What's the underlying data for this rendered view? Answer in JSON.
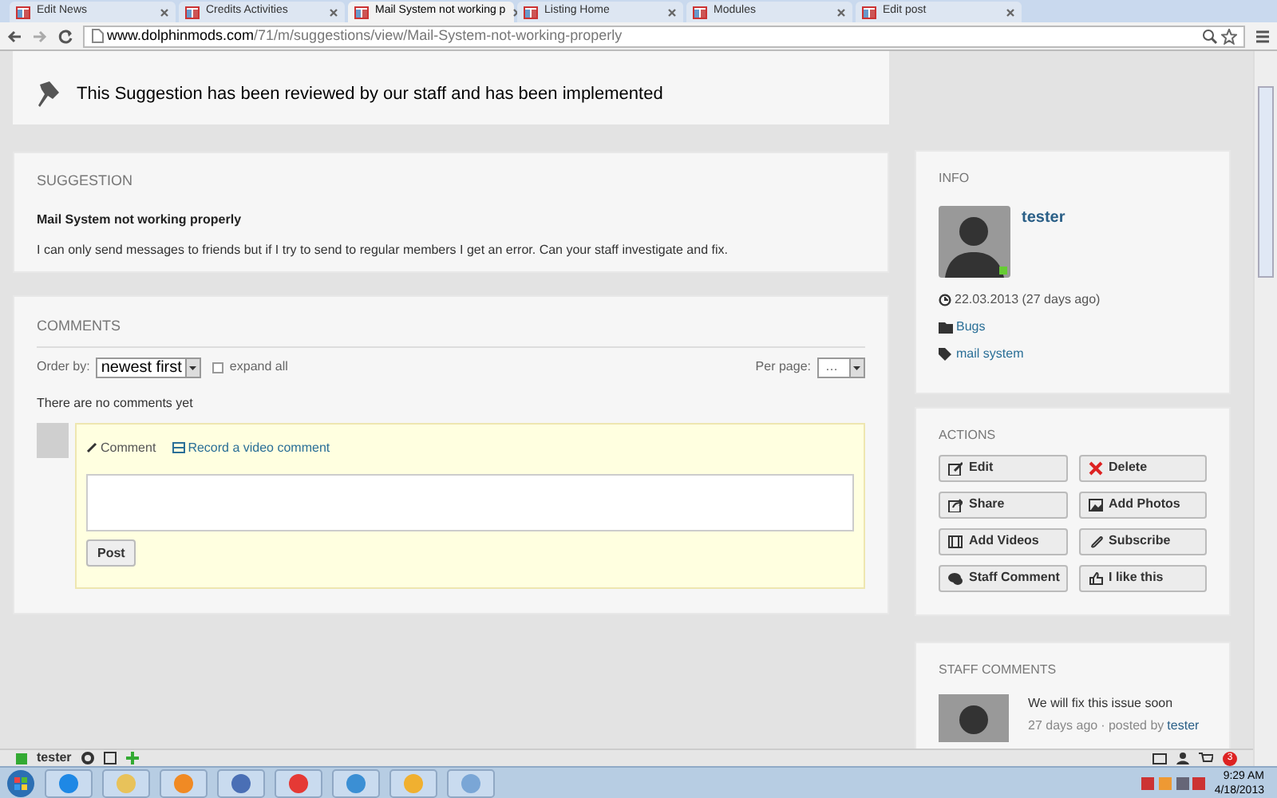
{
  "browser": {
    "tabs": [
      {
        "label": "Edit News",
        "selected": false
      },
      {
        "label": "Credits Activities",
        "selected": false
      },
      {
        "label": "Mail System not working p",
        "selected": true
      },
      {
        "label": "Listing Home",
        "selected": false
      },
      {
        "label": "Modules",
        "selected": false
      },
      {
        "label": "Edit post",
        "selected": false
      }
    ],
    "url_host": "www.dolphinmods.com",
    "url_path": "/71/m/suggestions/view/Mail-System-not-working-properly"
  },
  "notice": "This Suggestion has been reviewed by our staff and has been implemented",
  "suggestion": {
    "heading": "SUGGESTION",
    "title": "Mail System not working properly",
    "body": "I can only send messages to friends but if I try to send to regular members I get an error. Can your staff investigate and fix."
  },
  "comments": {
    "heading": "COMMENTS",
    "order_label": "Order by:",
    "order_value": "newest first",
    "expand_all": {
      "label": "expand all",
      "checked": false
    },
    "per_page_label": "Per page:",
    "per_page_value": "…",
    "empty_text": "There are no comments yet",
    "composer_tabs": [
      {
        "label": "Comment",
        "selected": true
      },
      {
        "label": "Record a video comment",
        "selected": false
      }
    ],
    "post_button": "Post"
  },
  "info": {
    "heading": "INFO",
    "author": "tester",
    "date": "22.03.2013 (27 days ago)",
    "category": "Bugs",
    "tag": "mail system"
  },
  "actions": {
    "heading": "ACTIONS",
    "buttons": [
      "Edit",
      "Delete",
      "Share",
      "Add Photos",
      "Add Videos",
      "Subscribe",
      "Staff Comment",
      "I like this"
    ]
  },
  "staff_comments": {
    "heading": "STAFF COMMENTS",
    "items": [
      {
        "text": "We will fix this issue soon",
        "time": "27 days ago",
        "posted_by": "· posted by",
        "author": "tester"
      }
    ]
  },
  "site_toolbar": {
    "user": "tester",
    "badge": "3"
  },
  "taskbar": {
    "time": "9:29 AM",
    "date": "4/18/2013"
  }
}
